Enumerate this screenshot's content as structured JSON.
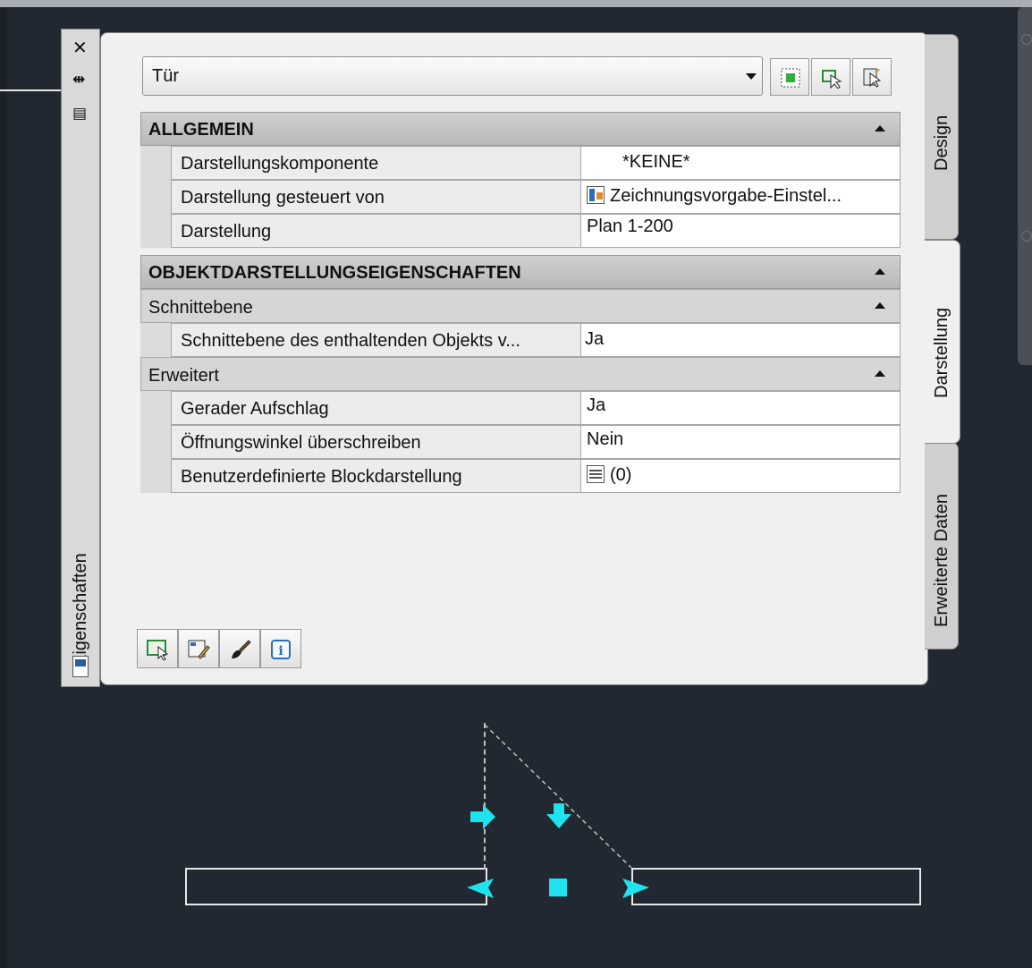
{
  "palette": {
    "title": "Eigenschaften",
    "object_type": "Tür",
    "tabs": [
      "Design",
      "Darstellung",
      "Erweiterte Daten"
    ],
    "active_tab": "Darstellung"
  },
  "sections": {
    "allgemein": {
      "label": "ALLGEMEIN",
      "rows": [
        {
          "name": "Darstellungskomponente",
          "value": "*KEINE*"
        },
        {
          "name": "Darstellung gesteuert von",
          "value": "Zeichnungsvorgabe-Einstel..."
        },
        {
          "name": "Darstellung",
          "value": "Plan 1-200"
        }
      ]
    },
    "objekt": {
      "label": "OBJEKTDARSTELLUNGSEIGENSCHAFTEN",
      "schnitt": {
        "label": "Schnittebene",
        "rows": [
          {
            "name": "Schnittebene des enthaltenden Objekts v...",
            "value": "Ja"
          }
        ]
      },
      "erweitert": {
        "label": "Erweitert",
        "rows": [
          {
            "name": "Gerader Aufschlag",
            "value": "Ja"
          },
          {
            "name": "Öffnungswinkel überschreiben",
            "value": "Nein"
          },
          {
            "name": "Benutzerdefinierte Blockdarstellung",
            "value": "(0)"
          }
        ]
      }
    }
  },
  "icons": {
    "titlebar": [
      "close-icon",
      "auto-hide-icon",
      "properties-menu-icon",
      "palette-settings-icon"
    ],
    "toolbar": [
      "quick-select-icon",
      "select-objects-icon",
      "toggle-pickadd-icon"
    ],
    "bottom": [
      "edit-style-icon",
      "edit-display-icon",
      "match-properties-icon",
      "info-icon"
    ]
  },
  "colors": {
    "canvas": "#222831",
    "grip": "#1ee3ee"
  }
}
